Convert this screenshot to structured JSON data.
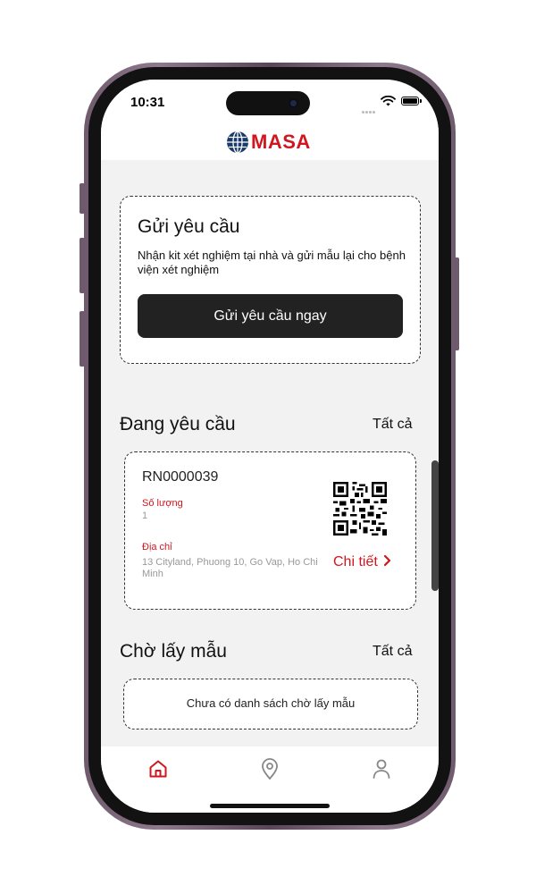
{
  "status_bar": {
    "time": "10:31"
  },
  "header": {
    "logo_text": "MASA"
  },
  "request_card": {
    "title": "Gửi yêu cầu",
    "description": "Nhận kit xét nghiệm tại nhà và gửi mẫu lại cho bệnh viện xét nghiệm",
    "button_label": "Gửi yêu cầu ngay"
  },
  "pending_section": {
    "title": "Đang yêu cầu",
    "see_all_label": "Tất cả",
    "items": [
      {
        "code": "RN0000039",
        "quantity_label": "Số lượng",
        "quantity_value": "1",
        "address_label": "Địa chỉ",
        "address_value": "13 Cityland, Phuong 10, Go Vap, Ho Chi Minh",
        "detail_label": "Chi tiết",
        "detail_icon": "chevron-right-icon"
      }
    ]
  },
  "waiting_section": {
    "title": "Chờ lấy mẫu",
    "see_all_label": "Tất cả",
    "empty_text": "Chưa có danh sách chờ lấy mẫu"
  },
  "tab_bar": {
    "tabs": [
      {
        "icon": "home-icon",
        "active": true
      },
      {
        "icon": "location-pin-icon",
        "active": false
      },
      {
        "icon": "user-icon",
        "active": false
      }
    ]
  },
  "colors": {
    "brand": "#d0161e",
    "button": "#222222",
    "active_tab": "#d0161e",
    "inactive_tab": "#888888"
  }
}
